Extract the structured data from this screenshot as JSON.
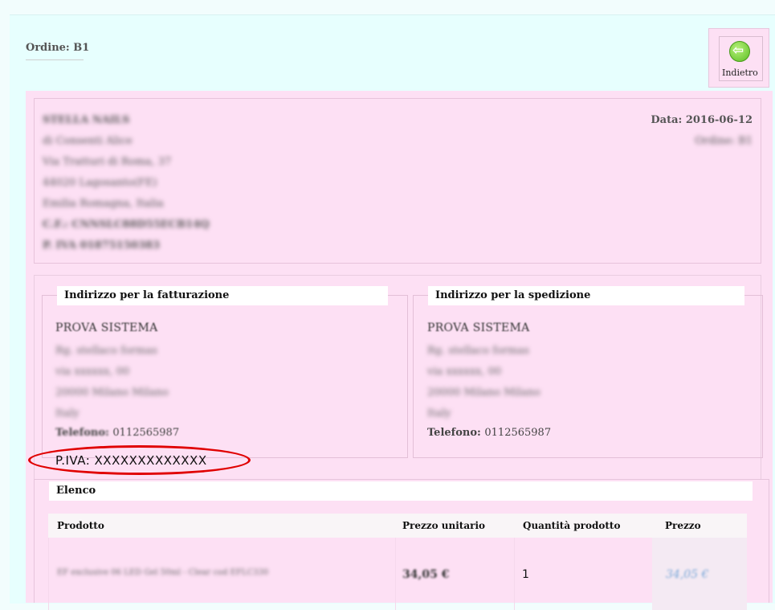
{
  "header": {
    "order_title": "Ordine: B1",
    "back_label": "Indietro",
    "back_icon": "back-arrow-icon"
  },
  "company": {
    "lines": [
      "STELLA NAILS",
      "di Consenti Alice",
      "Via Tratturi di Roma, 37",
      "44020 Lagosanto(FE)",
      "Emilia Romagna, Italia",
      "C.F.: CNNSLC88D55ECB14Q",
      "P. IVA 01875150383"
    ],
    "date": "Data: 2016-06-12",
    "order_ref": "Ordine: B1"
  },
  "billing": {
    "legend": "Indirizzo per la fatturazione",
    "name": "PROVA SISTEMA",
    "lines": [
      "Rg. stellaco formas",
      "via xxxxxx, 00",
      "20000 Milano Milano",
      "Italy"
    ],
    "phone_label": "Telefono:",
    "phone": "0112565987"
  },
  "shipping": {
    "legend": "Indirizzo per la spedizione",
    "name": "PROVA SISTEMA",
    "lines": [
      "Rg. stellaco formas",
      "via xxxxxx, 00",
      "20000 Milano Milano",
      "Italy"
    ],
    "phone_label": "Telefono:",
    "phone": "0112565987"
  },
  "piva": {
    "text": "P.IVA: XXXXXXXXXXXXX",
    "highlight_color": "#e00000"
  },
  "list": {
    "legend": "Elenco",
    "columns": [
      "Prodotto",
      "Prezzo unitario",
      "Quantità prodotto",
      "Prezzo"
    ],
    "rows": [
      {
        "product": "EF exclusive 06 LED Gel 50ml - Clear cod EFLC330",
        "unit_price": "34,05 €",
        "quantity": "1",
        "price": "34,05 €"
      }
    ]
  },
  "colors": {
    "page_bg": "#e7fffe",
    "content_bg": "#fde0f4",
    "legend_bg": "#ffffff"
  }
}
